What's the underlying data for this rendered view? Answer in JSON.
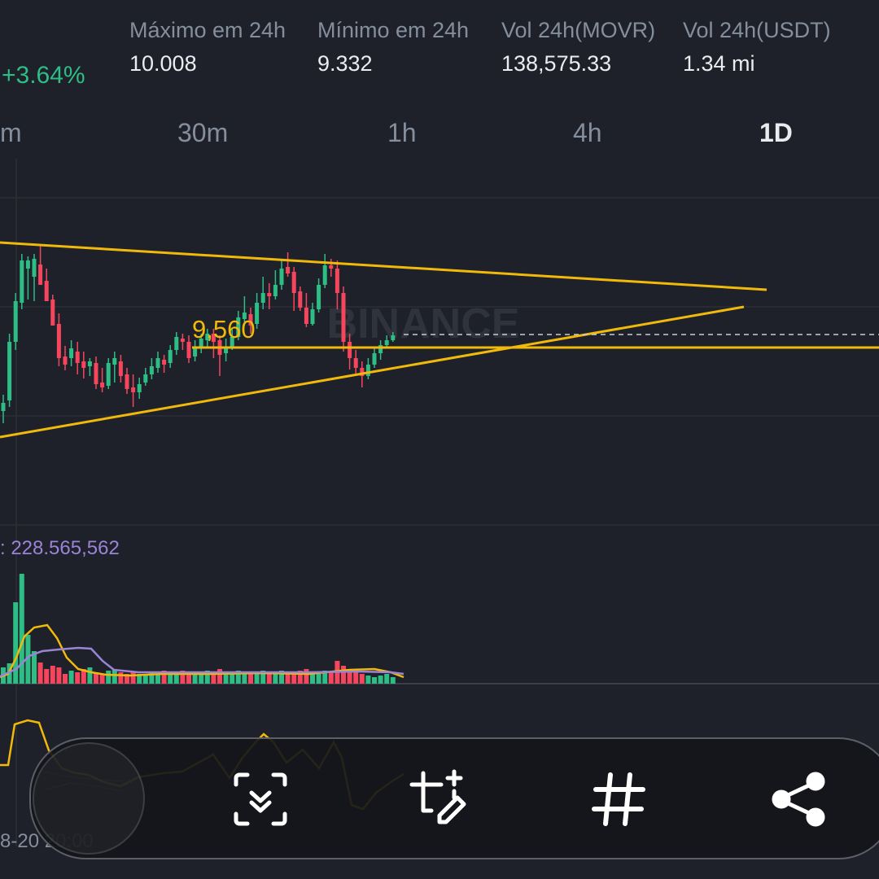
{
  "ticker": {
    "change": "+3.64%",
    "stats": [
      {
        "label": "Máximo em 24h",
        "value": "10.008"
      },
      {
        "label": "Mínimo em 24h",
        "value": "9.332"
      },
      {
        "label": "Vol 24h(MOVR)",
        "value": "138,575.33"
      },
      {
        "label": "Vol 24h(USDT)",
        "value": "1.34 mi"
      }
    ]
  },
  "intervals": [
    {
      "label": "m",
      "active": false
    },
    {
      "label": "30m",
      "active": false
    },
    {
      "label": "1h",
      "active": false
    },
    {
      "label": "4h",
      "active": false
    },
    {
      "label": "1D",
      "active": true
    }
  ],
  "chart": {
    "price_line_label": "9,560",
    "watermark": "BINANCE",
    "volume_label": ": 228.565,562",
    "date_label": "8-20 20:00",
    "colors": {
      "up": "#2ebd85",
      "down": "#f6465d",
      "drawing": "#f0b90b",
      "ma_purple": "#9b84d6"
    }
  },
  "toolbar": {
    "buttons": [
      {
        "name": "scroll-screenshot-icon"
      },
      {
        "name": "crop-edit-icon"
      },
      {
        "name": "hashtag-icon"
      },
      {
        "name": "share-icon"
      }
    ]
  }
}
